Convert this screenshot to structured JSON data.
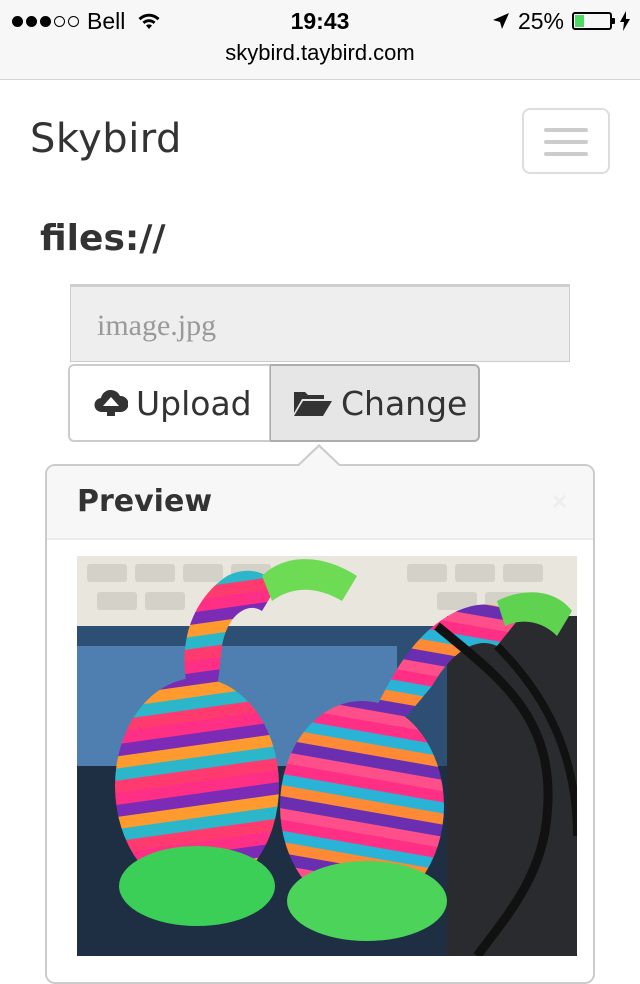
{
  "status_bar": {
    "carrier": "Bell",
    "time": "19:43",
    "battery": "25%",
    "battery_level": 0.25,
    "url": "skybird.taybird.com"
  },
  "navbar": {
    "brand": "Skybird",
    "menu_icon": "hamburger-icon"
  },
  "page": {
    "heading": "files://"
  },
  "file_input": {
    "placeholder": "image.jpg"
  },
  "buttons": {
    "upload": {
      "label": "Upload",
      "icon": "cloud-upload-icon"
    },
    "change": {
      "label": "Change",
      "icon": "folder-open-icon"
    }
  },
  "popover": {
    "title": "Preview",
    "close": "×",
    "image": "rainbow-sock-juggling-balls"
  },
  "colors": {
    "battery": "#4cd964",
    "button_active_bg": "#e6e6e6",
    "popover_header_bg": "#f7f7f7"
  }
}
